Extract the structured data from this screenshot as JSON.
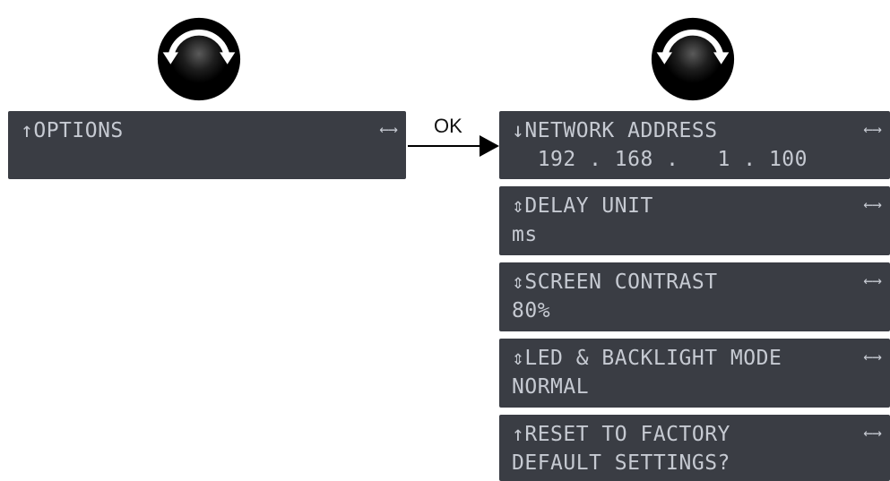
{
  "left_screen": {
    "line1": "↑OPTIONS",
    "nav": "←→"
  },
  "ok_label": "OK",
  "right_screens": [
    {
      "line1": "↓NETWORK ADDRESS",
      "line2": "  192 . 168 .   1 . 100",
      "nav": "←→"
    },
    {
      "line1": "⇕DELAY UNIT",
      "line2": "ms",
      "nav": "←→"
    },
    {
      "line1": "⇕SCREEN CONTRAST",
      "line2": "80%",
      "nav": "←→"
    },
    {
      "line1": "⇕LED & BACKLIGHT MODE",
      "line2": "NORMAL",
      "nav": "←→"
    },
    {
      "line1": "↑RESET TO FACTORY",
      "line2": "DEFAULT SETTINGS?",
      "nav": "←→"
    }
  ],
  "colors": {
    "lcd_bg": "#3a3d44",
    "lcd_text": "#c6cad2"
  },
  "icons": {
    "knob": "rotary-knob-icon",
    "arrow": "arrow-right-icon"
  }
}
